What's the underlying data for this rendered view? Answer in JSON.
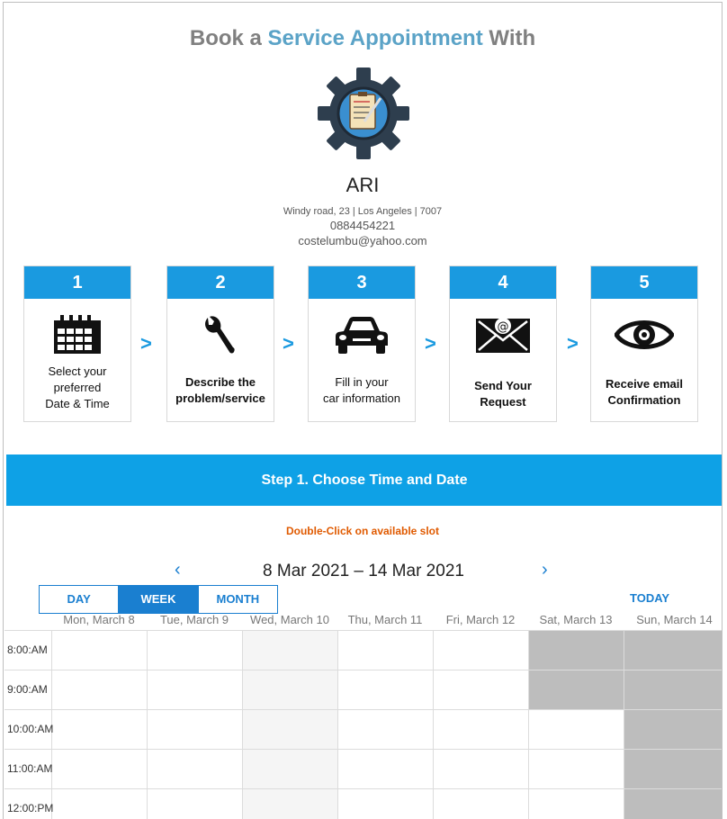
{
  "header": {
    "title_prefix": "Book a ",
    "title_accent": "Service Appointment",
    "title_suffix": " With"
  },
  "business": {
    "name": "ARI",
    "address": "Windy road, 23 | Los Angeles | 7007",
    "phone": "0884454221",
    "email": "costelumbu@yahoo.com"
  },
  "steps": [
    {
      "num": "1",
      "line1": "Select your",
      "line2": "preferred",
      "line3": "Date & Time",
      "icon": "calendar-icon"
    },
    {
      "num": "2",
      "line1": "Describe the",
      "line2": "problem/service",
      "icon": "wrench-icon"
    },
    {
      "num": "3",
      "line1": "Fill in your",
      "line2": "car information",
      "icon": "car-icon"
    },
    {
      "num": "4",
      "line1": "Send Your",
      "line2": "Request",
      "icon": "envelope-icon"
    },
    {
      "num": "5",
      "line1": "Receive email",
      "line2": "Confirmation",
      "icon": "eye-icon"
    }
  ],
  "step_separator": ">",
  "banner": "Step 1. Choose Time and Date",
  "hint": "Double-Click on available slot",
  "calendar": {
    "range": "8 Mar 2021 – 14 Mar 2021",
    "prev": "‹",
    "next": "›",
    "views": [
      "DAY",
      "WEEK",
      "MONTH"
    ],
    "active_view": "WEEK",
    "today": "TODAY",
    "days": [
      "Mon, March 8",
      "Tue, March 9",
      "Wed, March 10",
      "Thu, March 11",
      "Fri, March 12",
      "Sat, March 13",
      "Sun, March 14"
    ],
    "times": [
      "8:00:AM",
      "9:00:AM",
      "10:00:AM",
      "11:00:AM",
      "12:00:PM"
    ]
  },
  "colors": {
    "accent": "#5ba3c7",
    "step_blue": "#1a9ae0",
    "banner": "#0ea1e6",
    "hint": "#e05a00",
    "link_blue": "#1a7fd0",
    "unavailable": "#bdbdbd",
    "today_column": "#f5f5f5"
  }
}
